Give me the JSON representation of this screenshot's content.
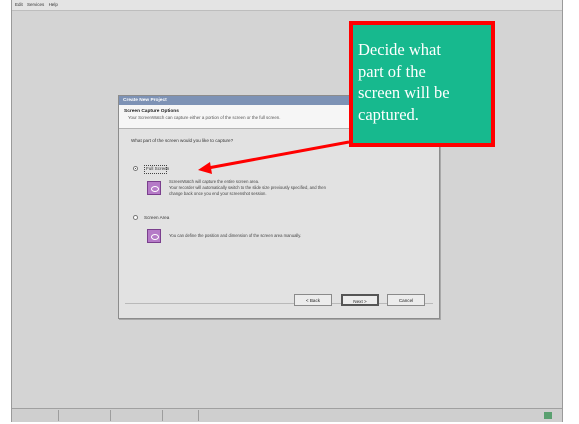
{
  "menubar": {
    "items": [
      "Edit",
      "Services",
      "Help"
    ]
  },
  "dialog": {
    "title": "Create New Project",
    "header_title": "Screen Capture Options",
    "header_subtitle": "Your ScreenWatch can capture either a portion of the screen or the full screen.",
    "question": "What part of the screen would you like to capture?",
    "option1_label": "Full Screen",
    "option1_desc_line1": "ScreenWatch will capture the entire screen area.",
    "option1_desc_line2": "Your recorder will automatically switch to the slide size previously specified, and then",
    "option1_desc_line3": "change back once you end your screenshot session.",
    "option2_label": "Screen Area",
    "option2_desc": "You can define the position and dimension of the screen area manually.",
    "buttons": {
      "back": "< Back",
      "next": "Next >",
      "cancel": "Cancel"
    }
  },
  "callout": {
    "lines": [
      "Decide what",
      "part of the",
      "screen will be",
      "captured."
    ],
    "fill_color": "#17b98e",
    "border_color": "#ff0000"
  }
}
